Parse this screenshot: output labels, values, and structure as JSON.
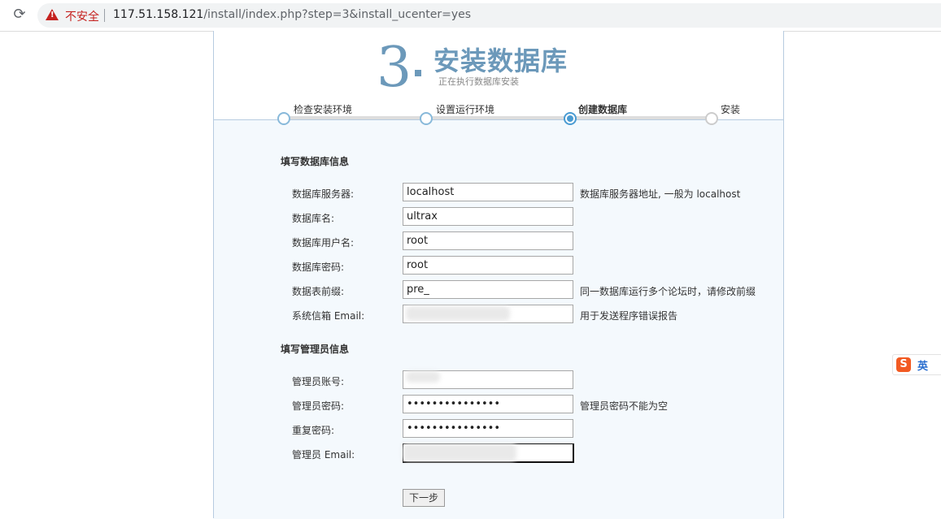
{
  "browser": {
    "reload_icon": "reload-icon",
    "security_label": "不安全",
    "url_host": "117.51.158.121",
    "url_path": "/install/index.php?step=3&install_ucenter=yes"
  },
  "header": {
    "step_number": "3",
    "title": "安装数据库",
    "subtitle": "正在执行数据库安装"
  },
  "progress": {
    "steps": [
      {
        "label": "检查安装环境",
        "state": "done"
      },
      {
        "label": "设置运行环境",
        "state": "done"
      },
      {
        "label": "创建数据库",
        "state": "current"
      },
      {
        "label": "安装",
        "state": "todo"
      }
    ]
  },
  "db_section": {
    "title": "填写数据库信息",
    "rows": [
      {
        "label": "数据库服务器:",
        "value": "localhost",
        "hint": "数据库服务器地址, 一般为 localhost"
      },
      {
        "label": "数据库名:",
        "value": "ultrax",
        "hint": ""
      },
      {
        "label": "数据库用户名:",
        "value": "root",
        "hint": ""
      },
      {
        "label": "数据库密码:",
        "value": "root",
        "hint": ""
      },
      {
        "label": "数据表前缀:",
        "value": "pre_",
        "hint": "同一数据库运行多个论坛时，请修改前缀"
      },
      {
        "label": "系统信箱 Email:",
        "value": "",
        "hint": "用于发送程序错误报告"
      }
    ]
  },
  "admin_section": {
    "title": "填写管理员信息",
    "rows": [
      {
        "label": "管理员账号:",
        "value": "",
        "hint": ""
      },
      {
        "label": "管理员密码:",
        "value": "•••••••••••••••",
        "hint": "管理员密码不能为空"
      },
      {
        "label": "重复密码:",
        "value": "•••••••••••••••",
        "hint": ""
      },
      {
        "label": "管理员 Email:",
        "value": "",
        "hint": ""
      }
    ]
  },
  "next_button": "下一步",
  "ime": {
    "logo": "S",
    "label": "英"
  },
  "colors": {
    "accent": "#6c99ba",
    "panel_bg": "#f4f9fd",
    "insecure": "#c5221f"
  }
}
